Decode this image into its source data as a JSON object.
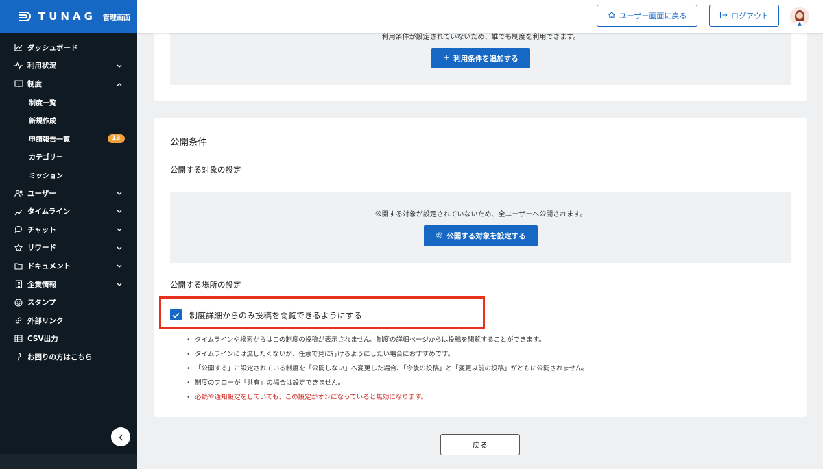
{
  "brand": {
    "name": "TUNAG",
    "subtitle": "管理画面"
  },
  "sidebar": {
    "items": [
      {
        "label": "ダッシュボード",
        "icon": "chart-icon"
      },
      {
        "label": "利用状況",
        "icon": "activity-icon",
        "chevron": "down"
      },
      {
        "label": "制度",
        "icon": "book-icon",
        "chevron": "up"
      },
      {
        "label": "制度一覧",
        "sub": true
      },
      {
        "label": "新規作成",
        "sub": true
      },
      {
        "label": "申請報告一覧",
        "sub": true,
        "badge": "13"
      },
      {
        "label": "カテゴリー",
        "sub": true
      },
      {
        "label": "ミッション",
        "sub": true
      },
      {
        "label": "ユーザー",
        "icon": "users-icon",
        "chevron": "down"
      },
      {
        "label": "タイムライン",
        "icon": "timeline-icon",
        "chevron": "down"
      },
      {
        "label": "チャット",
        "icon": "chat-icon",
        "chevron": "down"
      },
      {
        "label": "リワード",
        "icon": "star-icon",
        "chevron": "down"
      },
      {
        "label": "ドキュメント",
        "icon": "folder-icon",
        "chevron": "down"
      },
      {
        "label": "企業情報",
        "icon": "building-icon",
        "chevron": "down"
      },
      {
        "label": "スタンプ",
        "icon": "smile-icon"
      },
      {
        "label": "外部リンク",
        "icon": "link-icon"
      },
      {
        "label": "CSV出力",
        "icon": "table-icon"
      },
      {
        "label": "お困りの方はこちら",
        "icon": "help-icon"
      }
    ]
  },
  "header": {
    "user_screen_label": "ユーザー画面に戻る",
    "logout_label": "ログアウト"
  },
  "usage_conditions": {
    "info": "利用条件が設定されていないため、誰でも制度を利用できます。",
    "add_button": "利用条件を追加する"
  },
  "publish": {
    "title": "公開条件",
    "target_title": "公開する対象の設定",
    "target_info": "公開する対象が設定されていないため、全ユーザーへ公開されます。",
    "target_button": "公開する対象を設定する",
    "place_title": "公開する場所の設定",
    "checkbox_label": "制度詳細からのみ投稿を閲覧できるようにする",
    "checkbox_checked": true,
    "notes": [
      "タイムラインや検索からはこの制度の投稿が表示されません。制度の詳細ページからは投稿を閲覧することができます。",
      "タイムラインには流したくないが、任意で見に行けるようにしたい場合におすすめです。",
      "「公開する」に設定されている制度を「公開しない」へ変更した場合、「今後の投稿」と「変更以前の投稿」がともに公開されません。",
      "制度のフローが「共有」の場合は設定できません。"
    ],
    "warning": "必読や通知設定をしていても、この設定がオンになっていると無効になります。"
  },
  "footer": {
    "back_label": "戻る"
  },
  "colors": {
    "primary": "#1668c4",
    "sidebar": "#0f1a22",
    "highlight": "#e8321e",
    "warning": "#d2251e",
    "badge": "#f0a13c"
  }
}
